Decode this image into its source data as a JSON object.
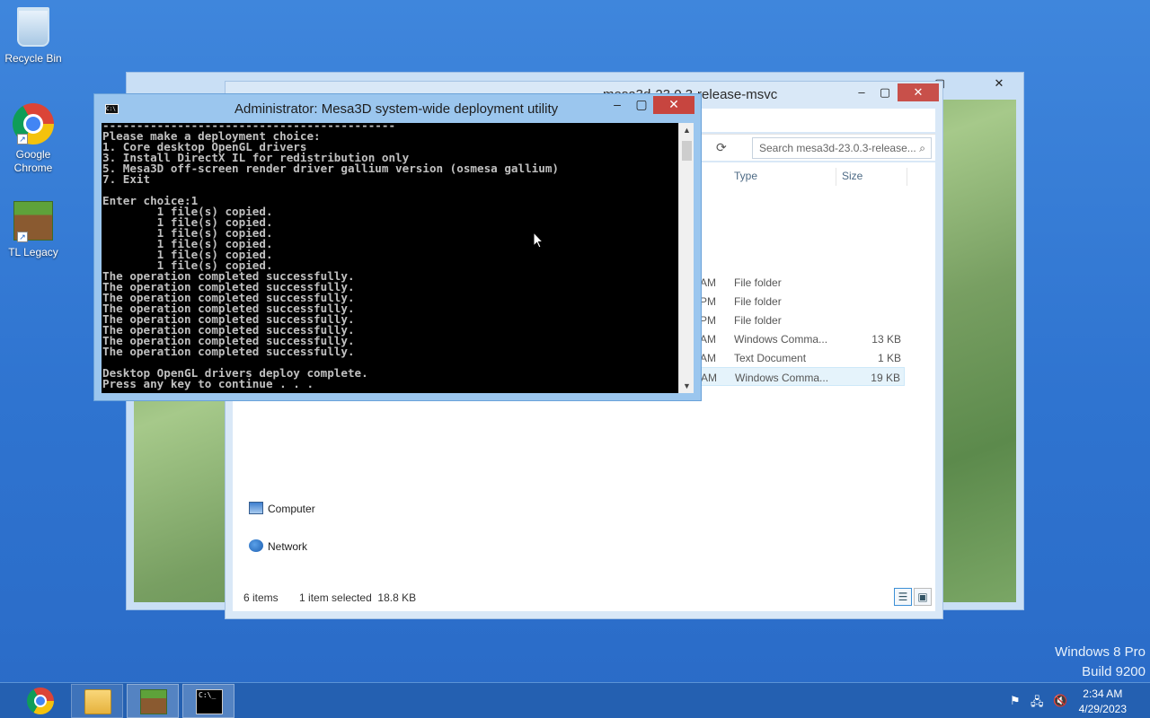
{
  "desktop": {
    "icons": [
      {
        "label": "Recycle Bin",
        "icon": "recycle-bin-icon"
      },
      {
        "label": "Google Chrome",
        "icon": "chrome-icon"
      },
      {
        "label": "TL Legacy",
        "icon": "minecraft-grass-block-icon"
      }
    ]
  },
  "watermark": {
    "line1": "Windows 8 Pro",
    "line2": "Build 9200"
  },
  "explorer": {
    "title": "mesa3d-23.0.3-release-msvc",
    "search_placeholder": "Search mesa3d-23.0.3-release...",
    "columns": {
      "type": "Type",
      "size": "Size"
    },
    "files": [
      {
        "date_tail": "AM",
        "type": "File folder",
        "size": ""
      },
      {
        "date_tail": "PM",
        "type": "File folder",
        "size": ""
      },
      {
        "date_tail": "PM",
        "type": "File folder",
        "size": ""
      },
      {
        "date_tail": "AM",
        "type": "Windows Comma...",
        "size": "13 KB"
      },
      {
        "date_tail": "AM",
        "type": "Text Document",
        "size": "1 KB"
      },
      {
        "date_tail": "AM",
        "type": "Windows Comma...",
        "size": "19 KB",
        "selected": true
      }
    ],
    "nav": {
      "computer": "Computer",
      "network": "Network"
    },
    "status": {
      "items": "6 items",
      "selection": "1 item selected  18.8 KB"
    }
  },
  "console": {
    "title": "Administrator:  Mesa3D system-wide deployment utility",
    "lines": [
      "-------------------------------------------",
      "Please make a deployment choice:",
      "1. Core desktop OpenGL drivers",
      "3. Install DirectX IL for redistribution only",
      "5. Mesa3D off-screen render driver gallium version (osmesa gallium)",
      "7. Exit",
      "",
      "Enter choice:1",
      "        1 file(s) copied.",
      "        1 file(s) copied.",
      "        1 file(s) copied.",
      "        1 file(s) copied.",
      "        1 file(s) copied.",
      "        1 file(s) copied.",
      "The operation completed successfully.",
      "The operation completed successfully.",
      "The operation completed successfully.",
      "The operation completed successfully.",
      "The operation completed successfully.",
      "The operation completed successfully.",
      "The operation completed successfully.",
      "The operation completed successfully.",
      "",
      "Desktop OpenGL drivers deploy complete.",
      "Press any key to continue . . ."
    ]
  },
  "taskbar": {
    "apps": [
      {
        "name": "Google Chrome",
        "icon": "chrome-icon"
      },
      {
        "name": "File Explorer",
        "icon": "folder-icon"
      },
      {
        "name": "TL Legacy",
        "icon": "minecraft-grass-block-icon"
      },
      {
        "name": "Command Prompt",
        "icon": "cmd-icon"
      }
    ],
    "clock": {
      "time": "2:34 AM",
      "date": "4/29/2023"
    }
  }
}
